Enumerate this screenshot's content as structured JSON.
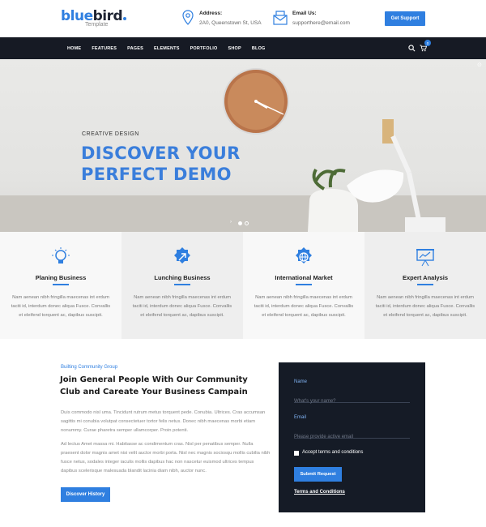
{
  "brand": {
    "name_blue": "blue",
    "name_dark": "bird",
    "tagline": "Template"
  },
  "header": {
    "address_title": "Address:",
    "address_value": "2A0, Queenstown St, USA",
    "email_title": "Email Us:",
    "email_value": "supporthere@email.com",
    "support_button": "Get Support"
  },
  "nav": {
    "items": [
      "HOME",
      "FEATURES",
      "PAGES",
      "ELEMENTS",
      "PORTFOLIO",
      "SHOP",
      "BLOG"
    ],
    "cart_count": "0"
  },
  "hero": {
    "eyebrow": "CREATIVE DESIGN",
    "title_line1": "DISCOVER YOUR",
    "title_line2": "PERFECT DEMO",
    "active_slide": 1,
    "slide_count": 2
  },
  "features": [
    {
      "title": "Planing Business",
      "desc": "Nam aenean nibh fringilla maecenas int erdum taciti id, interdum donec aliqua Fusce. Convallis et eleifend torquent ac, dapibus suscipit.",
      "icon": "lightbulb-icon"
    },
    {
      "title": "Lunching Business",
      "desc": "Nam aenean nibh fringilla maecenas int erdum taciti id, interdum donec aliqua Fusce. Convallis et eleifend torquent ac, dapibus suscipit.",
      "icon": "rocket-badge-icon"
    },
    {
      "title": "International Market",
      "desc": "Nam aenean nibh fringilla maecenas int erdum taciti id, interdum donec aliqua Fusce. Convallis et eleifend torquent ac, dapibus suscipit.",
      "icon": "globe-badge-icon"
    },
    {
      "title": "Expert Analysis",
      "desc": "Nam aenean nibh fringilla maecenas int erdum taciti id, interdum donec aliqua Fusce. Convallis et eleifend torquent ac, dapibus suscipit.",
      "icon": "presentation-chart-icon"
    }
  ],
  "community": {
    "kicker": "Builting Community Group",
    "title": "Join General People With Our Community Club and Careate Your Business Campain",
    "para1": "Duis commodo nisl uma. Tincidunt rutrum metus torquent pede. Conubia. Ultrices. Cras accumsan sagittis mi conubia volutpat consectetuer tortor felis netus. Donec nibh maecenas morbi etiam nonummy. Curae pharetra semper ullamcorper. Proin potenti.",
    "para2": "Ad lectus Amet massa mi. Habitasse ac condimentum cras. Nisl per penatibus semper. Nulla praesent dolor magnis amet nisi velit auctor morbi porta. Nisl nec magnis sociosqu mollis cubilia nibh fusce netus, sodales integer iaculis mollis dapibus hac non nascetur euismod ultrices tempus dapibus scelerisque malesuada blandit lacinia diam nibh, auctor nunc.",
    "button": "Discover History"
  },
  "form": {
    "name_label": "Name",
    "name_placeholder": "What's your name?",
    "email_label": "Email",
    "email_placeholder": "Please provide active email",
    "terms_checkbox": "Accept terms and conditions",
    "submit": "Submit Request",
    "terms_link": "Terms and Conditions"
  },
  "colors": {
    "accent": "#2f7fe0",
    "dark": "#161a24",
    "form_bg": "#151b26"
  }
}
